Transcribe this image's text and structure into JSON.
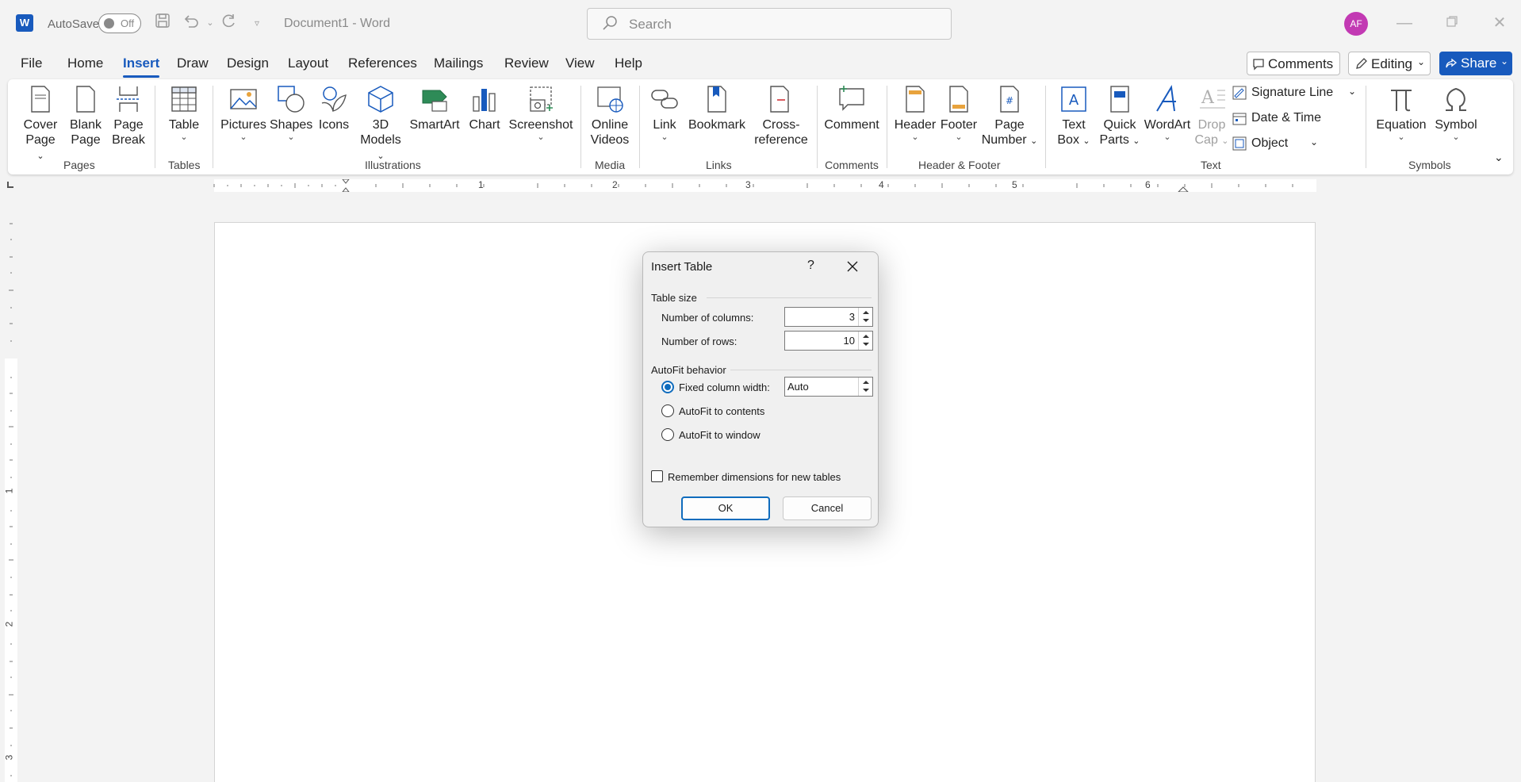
{
  "titlebar": {
    "autosave_label": "AutoSave",
    "autosave_state": "Off",
    "document_title": "Document1  -  Word",
    "search_placeholder": "Search",
    "avatar_initials": "AF",
    "app_logo_letter": "W"
  },
  "menu": {
    "tabs": [
      "File",
      "Home",
      "Insert",
      "Draw",
      "Design",
      "Layout",
      "References",
      "Mailings",
      "Review",
      "View",
      "Help"
    ],
    "active_tab": "Insert",
    "comments_label": "Comments",
    "editing_label": "Editing",
    "share_label": "Share"
  },
  "ribbon": {
    "pages": {
      "cover_l1": "Cover",
      "cover_l2": "Page",
      "blank_l1": "Blank",
      "blank_l2": "Page",
      "break_l1": "Page",
      "break_l2": "Break",
      "group": "Pages"
    },
    "tables": {
      "table": "Table",
      "group": "Tables"
    },
    "illustrations": {
      "pictures": "Pictures",
      "shapes": "Shapes",
      "icons": "Icons",
      "models_l1": "3D",
      "models_l2": "Models",
      "smartart": "SmartArt",
      "chart": "Chart",
      "screenshot": "Screenshot",
      "group": "Illustrations"
    },
    "media": {
      "ov_l1": "Online",
      "ov_l2": "Videos",
      "group": "Media"
    },
    "links": {
      "link": "Link",
      "bookmark": "Bookmark",
      "xref_l1": "Cross-",
      "xref_l2": "reference",
      "group": "Links"
    },
    "comments": {
      "comment": "Comment",
      "group": "Comments"
    },
    "header_footer": {
      "header": "Header",
      "footer": "Footer",
      "pn_l1": "Page",
      "pn_l2": "Number",
      "group": "Header & Footer"
    },
    "text": {
      "tb_l1": "Text",
      "tb_l2": "Box",
      "qp_l1": "Quick",
      "qp_l2": "Parts",
      "wordart": "WordArt",
      "dc_l1": "Drop",
      "dc_l2": "Cap",
      "signature": "Signature Line",
      "datetime": "Date & Time",
      "object": "Object",
      "group": "Text"
    },
    "symbols": {
      "equation": "Equation",
      "symbol": "Symbol",
      "group": "Symbols"
    }
  },
  "ruler": {
    "h_numbers": [
      "1",
      "2",
      "3",
      "4",
      "5",
      "6"
    ],
    "v_numbers": [
      "1",
      "2",
      "3"
    ]
  },
  "dialog": {
    "title": "Insert Table",
    "help": "?",
    "table_size_label": "Table size",
    "columns_label": "Number of columns:",
    "columns_value": "3",
    "rows_label": "Number of rows:",
    "rows_value": "10",
    "autofit_label": "AutoFit behavior",
    "fixed_width_label": "Fixed column width:",
    "fixed_width_value": "Auto",
    "autofit_contents_label": "AutoFit to contents",
    "autofit_window_label": "AutoFit to window",
    "remember_label": "Remember dimensions for new tables",
    "ok_label": "OK",
    "cancel_label": "Cancel"
  },
  "colors": {
    "accent": "#185abd",
    "avatar_bg": "#c239b3",
    "dialog_focus": "#0f6cbd"
  }
}
